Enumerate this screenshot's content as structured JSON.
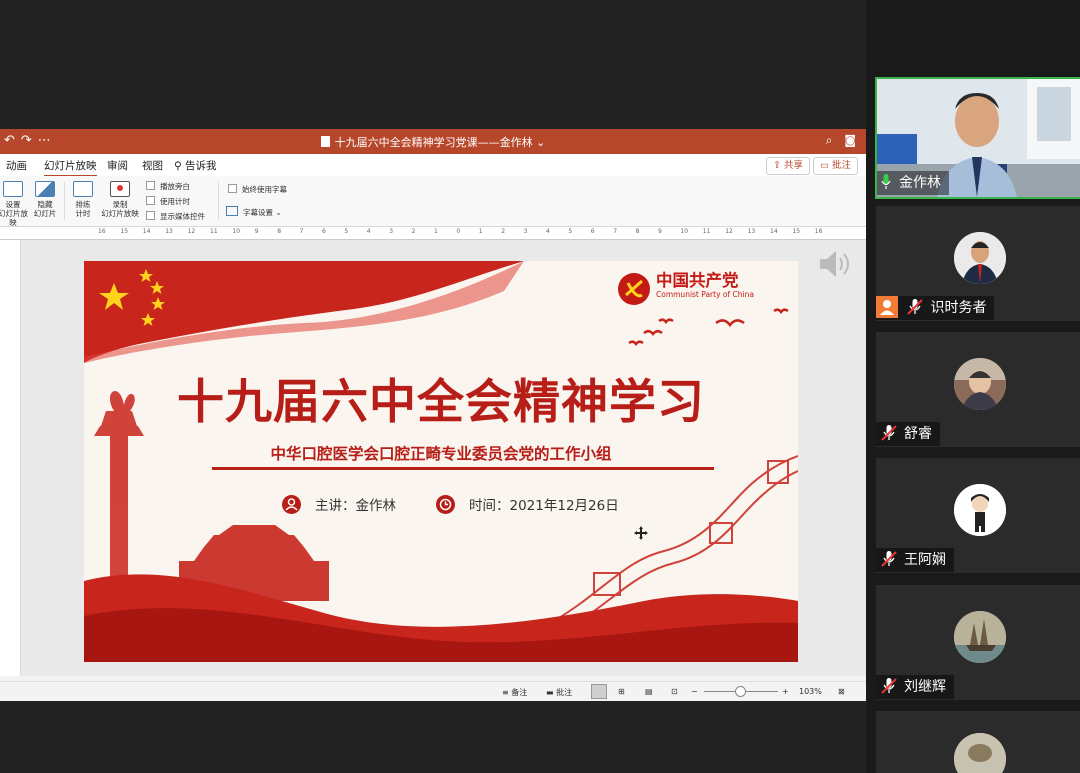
{
  "powerpoint": {
    "document_title": "十九届六中全会精神学习党课——金作林",
    "tabs": [
      "动画",
      "幻灯片放映",
      "审阅",
      "视图"
    ],
    "active_tab": "幻灯片放映",
    "tell_me": "告诉我",
    "share_label": "共享",
    "comments_label": "批注",
    "ribbon": {
      "setup_label_1": "设置",
      "setup_label_2": "幻灯片放映",
      "hide_label_1": "隐藏",
      "hide_label_2": "幻灯片",
      "rehearse_label_1": "排练",
      "rehearse_label_2": "计时",
      "record_label_1": "录制",
      "record_label_2": "幻灯片放映",
      "play_narrations": "播放旁白",
      "use_timings": "使用计时",
      "show_media_controls": "显示媒体控件",
      "always_use_subtitles": "始终使用字幕",
      "subtitle_settings": "字幕设置"
    },
    "ruler_ticks": [
      "16",
      "15",
      "14",
      "13",
      "12",
      "11",
      "10",
      "9",
      "8",
      "7",
      "6",
      "5",
      "4",
      "3",
      "2",
      "1",
      "0",
      "1",
      "2",
      "3",
      "4",
      "5",
      "6",
      "7",
      "8",
      "9",
      "10",
      "11",
      "12",
      "13",
      "14",
      "15",
      "16"
    ],
    "status": {
      "notes": "备注",
      "comments": "批注",
      "zoom": "103%"
    }
  },
  "slide": {
    "party_name": "中国共产党",
    "party_name_en": "Communist Party of China",
    "title": "十九届六中全会精神学习",
    "subtitle": "中华口腔医学会口腔正畸专业委员会党的工作小组",
    "speaker": "主讲：金作林",
    "date": "时间：2021年12月26日"
  },
  "participants": [
    {
      "name": "金作林",
      "active_speaker": true,
      "mic": "on"
    },
    {
      "name": "识时务者",
      "host": true,
      "mic": "off"
    },
    {
      "name": "舒睿",
      "mic": "off"
    },
    {
      "name": "王阿娴",
      "mic": "off"
    },
    {
      "name": "刘继辉",
      "mic": "off"
    },
    {
      "name": "",
      "mic": "off"
    }
  ],
  "colors": {
    "ppt_accent": "#b7472a",
    "slide_red": "#b81e18",
    "active_speaker_border": "#3bb44a",
    "host_badge": "#f27c35"
  }
}
